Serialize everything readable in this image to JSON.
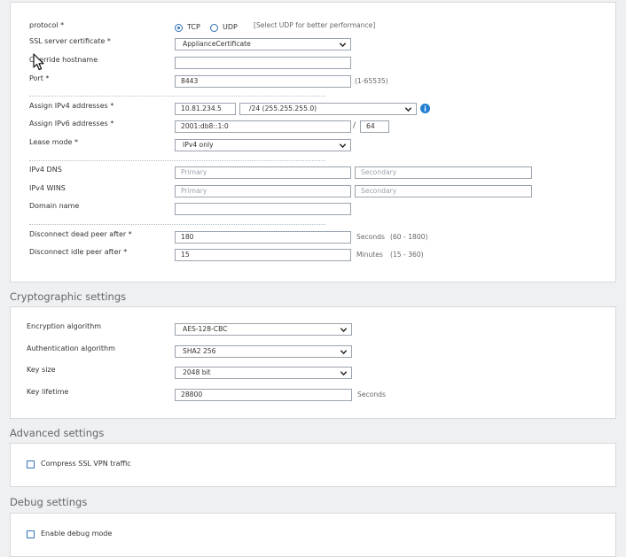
{
  "general": {
    "protocol_label": "protocol *",
    "tcp_label": "TCP",
    "udp_label": "UDP",
    "protocol_hint": "[Select UDP for better performance]",
    "ssl_cert_label": "SSL server certificate *",
    "ssl_cert_value": "ApplianceCertificate",
    "override_label": "Override hostname",
    "override_value": "",
    "port_label": "Port *",
    "port_value": "8443",
    "port_hint": "(1-65535)",
    "ipv4_label": "Assign IPv4 addresses *",
    "ipv4_value": "10.81.234.5",
    "ipv4_mask": "/24 (255.255.255.0)",
    "ipv6_label": "Assign IPv6 addresses *",
    "ipv6_value": "2001:db8::1:0",
    "ipv6_slash": "/",
    "ipv6_prefix": "64",
    "lease_label": "Lease mode *",
    "lease_value": "IPv4 only",
    "dns_label": "IPv4 DNS",
    "dns_primary_ph": "Primary",
    "dns_secondary_ph": "Secondary",
    "wins_label": "IPv4 WINS",
    "wins_primary_ph": "Primary",
    "wins_secondary_ph": "Secondary",
    "domain_label": "Domain name",
    "domain_value": "",
    "dead_label": "Disconnect dead peer after *",
    "dead_value": "180",
    "dead_unit": "Seconds",
    "dead_range": "(60 - 1800)",
    "idle_label": "Disconnect idle peer after *",
    "idle_value": "15",
    "idle_unit": "Minutes",
    "idle_range": "(15 - 360)"
  },
  "crypto": {
    "title": "Cryptographic settings",
    "enc_label": "Encryption algorithm",
    "enc_value": "AES-128-CBC",
    "auth_label": "Authentication algorithm",
    "auth_value": "SHA2 256",
    "key_label": "Key size",
    "key_value": "2048 bit",
    "life_label": "Key lifetime",
    "life_value": "28800",
    "life_unit": "Seconds"
  },
  "advanced": {
    "title": "Advanced settings",
    "compress_label": "Compress SSL VPN traffic"
  },
  "debug": {
    "title": "Debug settings",
    "enable_label": "Enable debug mode"
  },
  "colors": {
    "accent": "#2d6db5",
    "info": "#1f7fd1",
    "border": "#9aa3ad"
  }
}
